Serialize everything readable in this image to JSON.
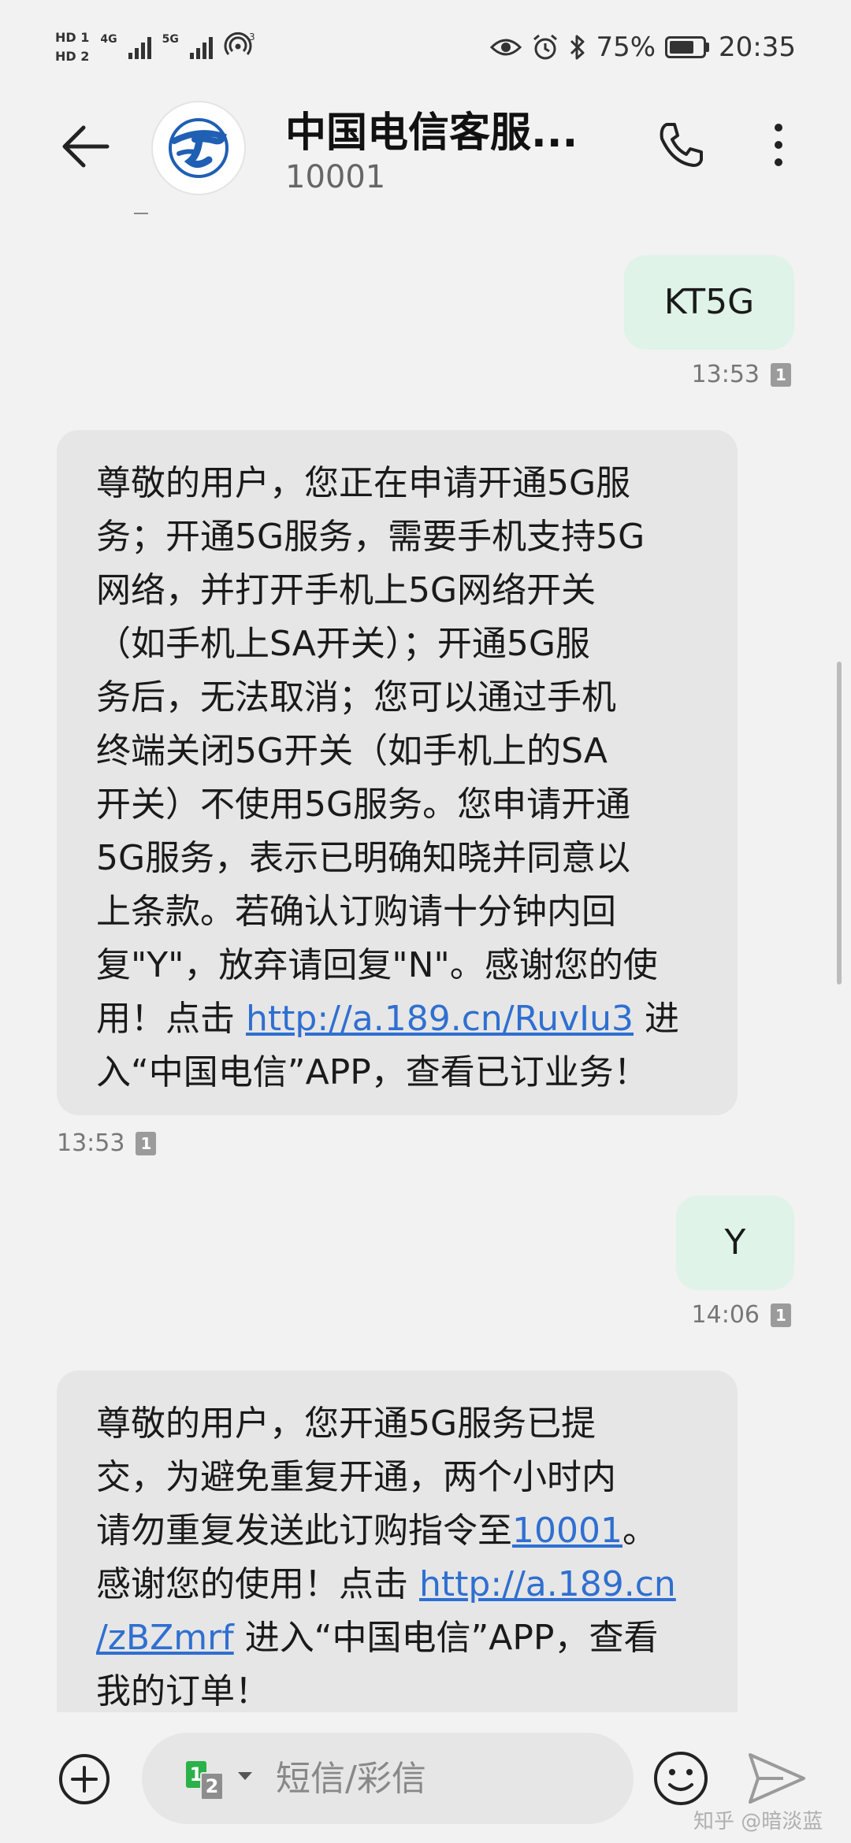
{
  "status_bar": {
    "hd1": "HD 1",
    "hd2": "HD 2",
    "net1": "4G",
    "net2": "5G",
    "wifi_badge": "3",
    "battery": "75%",
    "time": "20:35",
    "battery_level": 0.75,
    "icons": [
      "eye-icon",
      "alarm-icon",
      "bluetooth-icon",
      "battery-icon"
    ]
  },
  "header": {
    "contact_name": "中国电信客服...",
    "contact_number": "10001",
    "icons": [
      "back-arrow-icon",
      "china-telecom-logo",
      "phone-icon",
      "more-vertical-icon"
    ]
  },
  "messages": [
    {
      "direction": "outgoing",
      "text": "KT5G",
      "time": "13:53",
      "sim": "1"
    },
    {
      "direction": "incoming",
      "lines": [
        "尊敬的用户，您正在申请开通5G服",
        "务；开通5G服务，需要手机支持5G",
        "网络，并打开手机上5G网络开关",
        "（如手机上SA开关）；开通5G服",
        "务后，无法取消；您可以通过手机",
        "终端关闭5G开关（如手机上的SA",
        "开关）不使用5G服务。您申请开通",
        "5G服务，表示已明确知晓并同意以",
        "上条款。若确认订购请十分钟内回",
        "复\"Y\"，放弃请回复\"N\"。感谢您的使"
      ],
      "link_line_prefix": "用！点击 ",
      "link": "http://a.189.cn/RuvIu3",
      "link_line_suffix": " 进",
      "last_line": "入“中国电信”APP，查看已订业务！",
      "time": "13:53",
      "sim": "1"
    },
    {
      "direction": "outgoing",
      "text": "Y",
      "time": "14:06",
      "sim": "1"
    },
    {
      "direction": "incoming",
      "line1": "尊敬的用户，您开通5G服务已提",
      "line2": "交，为避免重复开通，两个小时内",
      "line3_prefix": "请勿重复发送此订购指令至",
      "line3_link": "10001",
      "line3_suffix": "。",
      "line4_prefix": "感谢您的使用！点击 ",
      "line4_link": "http://a.189.cn",
      "line5_link": "/zBZmrf",
      "line5_suffix": " 进入“中国电信”APP，查看",
      "line6": "我的订单！"
    }
  ],
  "composer": {
    "sim1": "1",
    "sim2": "2",
    "placeholder": "短信/彩信",
    "icons": [
      "add-circle-icon",
      "sim-select-icon",
      "emoji-icon",
      "send-icon"
    ]
  },
  "watermark": "知乎 @暗淡蓝"
}
